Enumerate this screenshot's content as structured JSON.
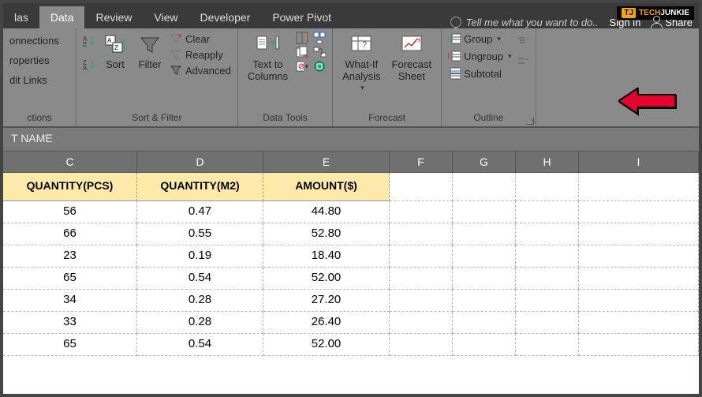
{
  "logo": {
    "badge": "TJ",
    "text1": "TECH",
    "text2": "JUNKIE"
  },
  "tabs": {
    "formulas": "las",
    "data": "Data",
    "review": "Review",
    "view": "View",
    "developer": "Developer",
    "powerpivot": "Power Pivot"
  },
  "tellme": "Tell me what you want to do..",
  "signin": "Sign in",
  "share": "Share",
  "ribbon": {
    "connections": {
      "conn": "onnections",
      "prop": "roperties",
      "edit": "dit Links",
      "label": "ctions"
    },
    "sortfilter": {
      "sort": "Sort",
      "filter": "Filter",
      "clear": "Clear",
      "reapply": "Reapply",
      "advanced": "Advanced",
      "label": "Sort & Filter"
    },
    "datatools": {
      "ttc": "Text to\nColumns",
      "label": "Data Tools"
    },
    "forecast": {
      "whatif": "What-If\nAnalysis",
      "sheet": "Forecast\nSheet",
      "label": "Forecast"
    },
    "outline": {
      "group": "Group",
      "ungroup": "Ungroup",
      "subtotal": "Subtotal",
      "label": "Outline"
    }
  },
  "formula_bar": "T NAME",
  "columns": [
    "C",
    "D",
    "E",
    "F",
    "G",
    "H",
    "I"
  ],
  "headers": {
    "c": "QUANTITY(PCS)",
    "d": "QUANTITY(M2)",
    "e": "AMOUNT($)"
  },
  "rows": [
    {
      "c": "56",
      "d": "0.47",
      "e": "44.80"
    },
    {
      "c": "66",
      "d": "0.55",
      "e": "52.80"
    },
    {
      "c": "23",
      "d": "0.19",
      "e": "18.40"
    },
    {
      "c": "65",
      "d": "0.54",
      "e": "52.00"
    },
    {
      "c": "34",
      "d": "0.28",
      "e": "27.20"
    },
    {
      "c": "33",
      "d": "0.28",
      "e": "26.40"
    },
    {
      "c": "65",
      "d": "0.54",
      "e": "52.00"
    }
  ]
}
